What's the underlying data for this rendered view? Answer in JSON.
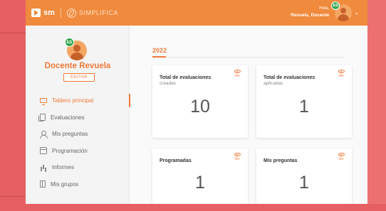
{
  "topbar": {
    "logo_text": "sm",
    "brand": "SIMPLIFICA",
    "greeting": "Hola,",
    "user_name": "Revuela, Docente",
    "language_badge": "ES"
  },
  "sidebar": {
    "language_badge": "ES",
    "profile_name": "Docente Revuela",
    "edit_label": "EDITAR",
    "items": [
      {
        "label": "Tablero principal",
        "icon": "monitor-icon",
        "active": true
      },
      {
        "label": "Evaluaciones",
        "icon": "copy-icon"
      },
      {
        "label": "Mis preguntas",
        "icon": "user-icon"
      },
      {
        "label": "Programación",
        "icon": "calendar-icon"
      },
      {
        "label": "Informes",
        "icon": "bar-chart-icon"
      },
      {
        "label": "Mis grupos",
        "icon": "book-icon"
      }
    ]
  },
  "main": {
    "year": "2022",
    "cards": [
      {
        "title": "Total de evaluaciones",
        "subtitle": "creadas",
        "value": "10",
        "view_label": "Ver"
      },
      {
        "title": "Total de evaluaciones",
        "subtitle": "aplicadas",
        "value": "1",
        "view_label": "Ver"
      },
      {
        "title": "Programadas",
        "subtitle": "",
        "value": "1",
        "view_label": "Ver"
      },
      {
        "title": "Mis preguntas",
        "subtitle": "",
        "value": "1",
        "view_label": "Ver"
      }
    ]
  },
  "colors": {
    "accent": "#ef7a3a",
    "topbar": "#f08a3c",
    "background": "#ec7070",
    "badge": "#34a853"
  }
}
